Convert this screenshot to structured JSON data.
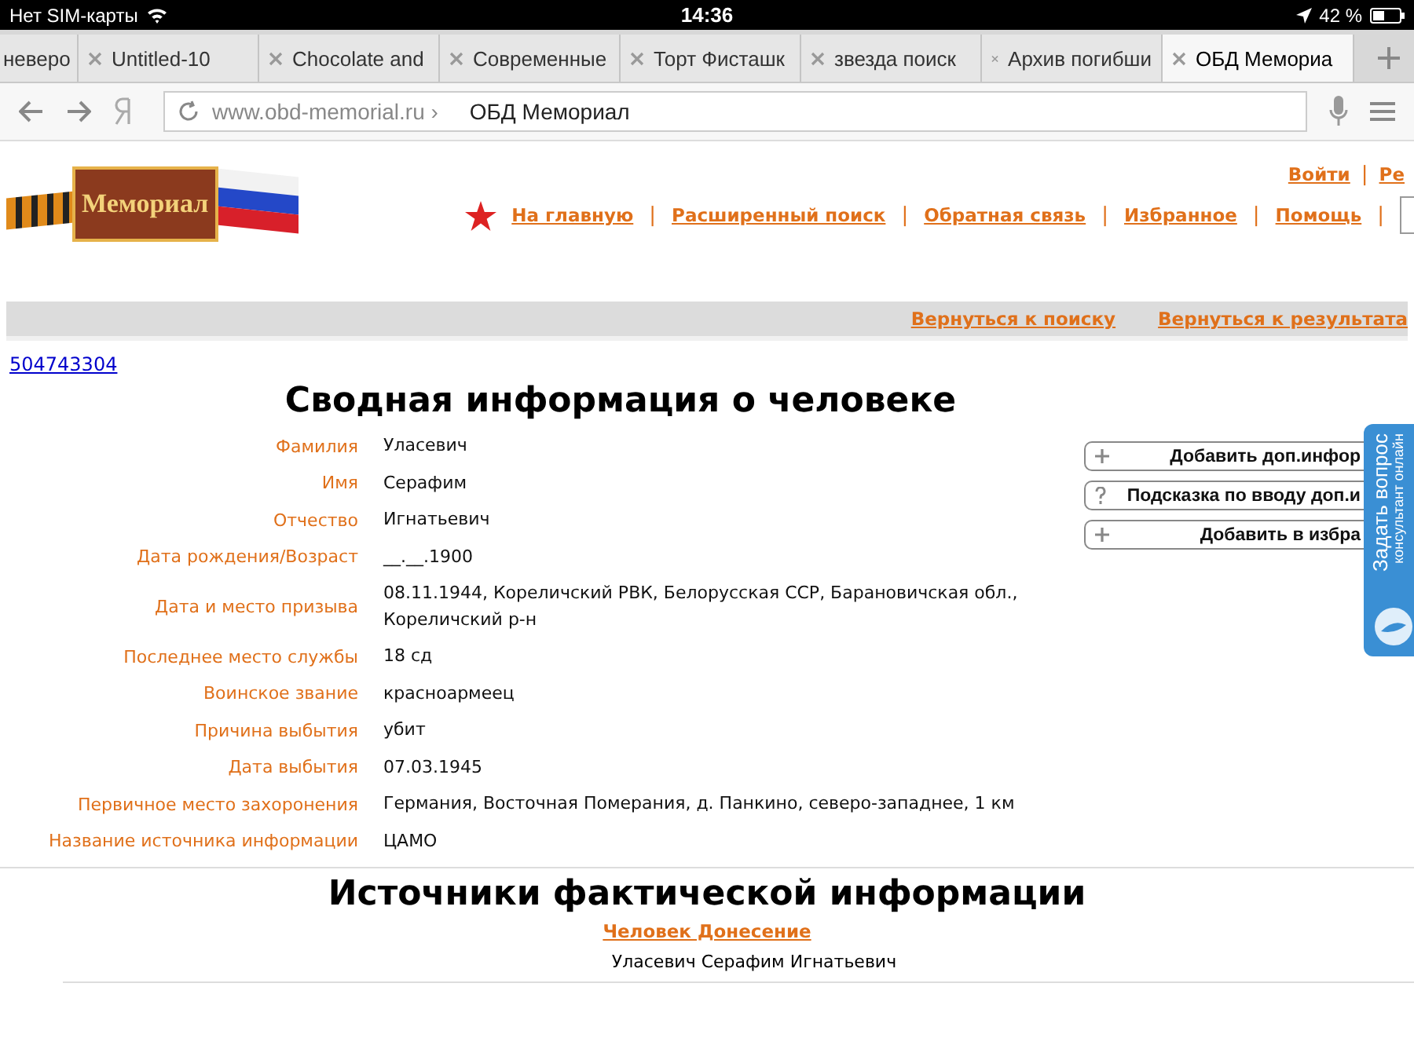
{
  "status_bar": {
    "carrier": "Нет SIM-карты",
    "time": "14:36",
    "battery": "42 %"
  },
  "tabs": [
    {
      "label": "неверо",
      "selected": false
    },
    {
      "label": "Untitled-10",
      "selected": false
    },
    {
      "label": "Chocolate and",
      "selected": false
    },
    {
      "label": "Современные",
      "selected": false
    },
    {
      "label": "Торт Фисташк",
      "selected": false
    },
    {
      "label": "звезда поиск",
      "selected": false
    },
    {
      "label": "Архив погибши",
      "selected": false
    },
    {
      "label": "ОБД Мемориа",
      "selected": true
    }
  ],
  "address_bar": {
    "domain": "www.obd-memorial.ru ›",
    "title": "ОБД Мемориал"
  },
  "header": {
    "logo": "Мемориал",
    "separator": "|",
    "account_links": [
      "Войти",
      "Ре"
    ],
    "nav": [
      "На главную",
      "Расширенный поиск",
      "Обратная связь",
      "Избранное",
      "Помощь"
    ]
  },
  "back_links": [
    "Вернуться к поиску",
    "Вернуться к результата"
  ],
  "record_id": "504743304",
  "title": "Сводная информация о человеке",
  "fields": [
    {
      "label": "Фамилия",
      "value": "Уласевич"
    },
    {
      "label": "Имя",
      "value": "Серафим"
    },
    {
      "label": "Отчество",
      "value": "Игнатьевич"
    },
    {
      "label": "Дата рождения/Возраст",
      "value": "__.__.1900"
    },
    {
      "label": "Дата и место призыва",
      "value": "08.11.1944, Кореличский РВК, Белорусская ССР, Барановичская обл., Кореличский р-н"
    },
    {
      "label": "Последнее место службы",
      "value": "18 сд"
    },
    {
      "label": "Воинское звание",
      "value": "красноармеец"
    },
    {
      "label": "Причина выбытия",
      "value": "убит"
    },
    {
      "label": "Дата выбытия",
      "value": "07.03.1945"
    },
    {
      "label": "Первичное место захоронения",
      "value": "Германия, Восточная Померания, д. Панкино, северо-западнее, 1 км"
    },
    {
      "label": "Название источника информации",
      "value": "ЦАМО"
    }
  ],
  "actions": [
    {
      "kind": "plus",
      "label": "Добавить доп.инфор"
    },
    {
      "kind": "help",
      "label": "Подсказка по вводу доп.и"
    },
    {
      "kind": "plus",
      "label": "Добавить в избра"
    }
  ],
  "chat_widget": {
    "title": "Задать вопрос",
    "subtitle": "консультант онлайн"
  },
  "sources": {
    "title": "Источники фактической информации",
    "link": "Человек Донесение",
    "person": "Уласевич Серафим Игнатьевич"
  }
}
